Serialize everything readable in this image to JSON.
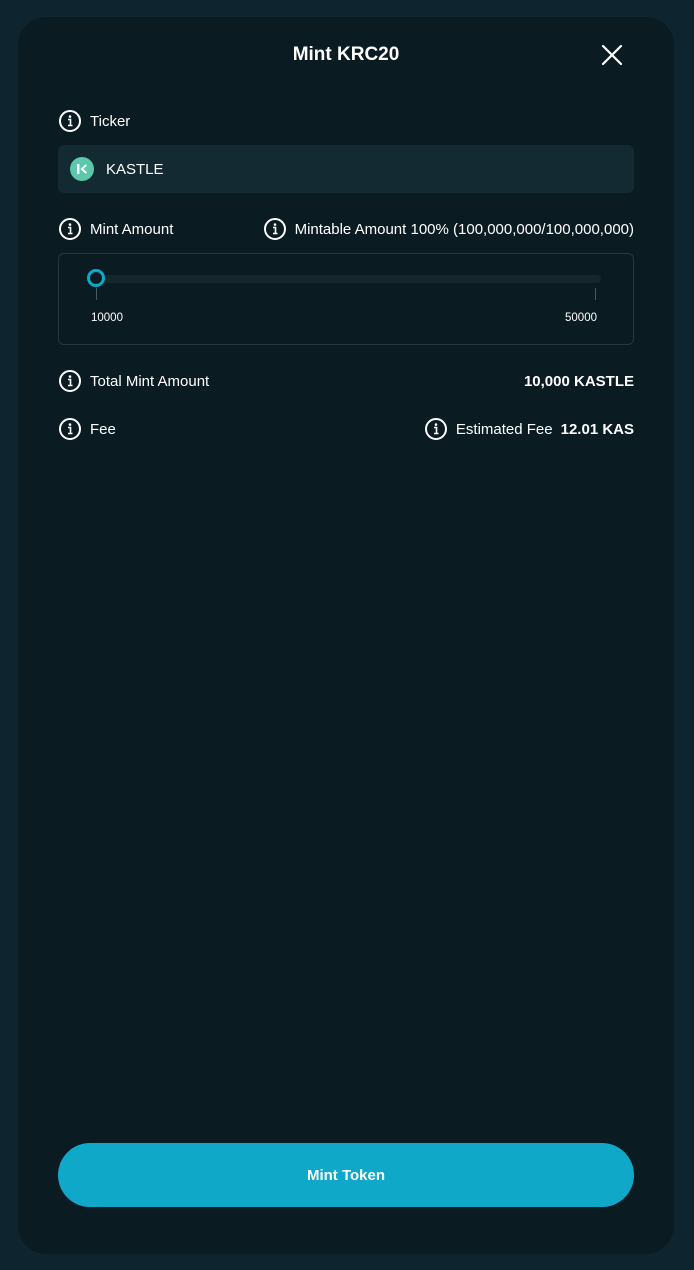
{
  "modal": {
    "title": "Mint KRC20"
  },
  "ticker": {
    "label": "Ticker",
    "value": "KASTLE",
    "logo_color": "#5cc7aa"
  },
  "mint_amount": {
    "label": "Mint Amount",
    "mintable_label": "Mintable Amount 100% (100,000,000/100,000,000)",
    "slider": {
      "min_label": "10000",
      "max_label": "50000",
      "min": 10000,
      "max": 50000,
      "value": 10000
    }
  },
  "total_mint": {
    "label": "Total Mint Amount",
    "value": "10,000 KASTLE"
  },
  "fee": {
    "label": "Fee",
    "estimated_label": "Estimated Fee",
    "estimated_value": "12.01 KAS"
  },
  "footer": {
    "mint_button_label": "Mint Token"
  },
  "colors": {
    "accent": "#0fa8c8",
    "modal_bg": "#0b1b22",
    "page_bg": "#0e2530"
  },
  "icons": [
    "close-icon",
    "info-icon",
    "kastle-logo-icon"
  ]
}
